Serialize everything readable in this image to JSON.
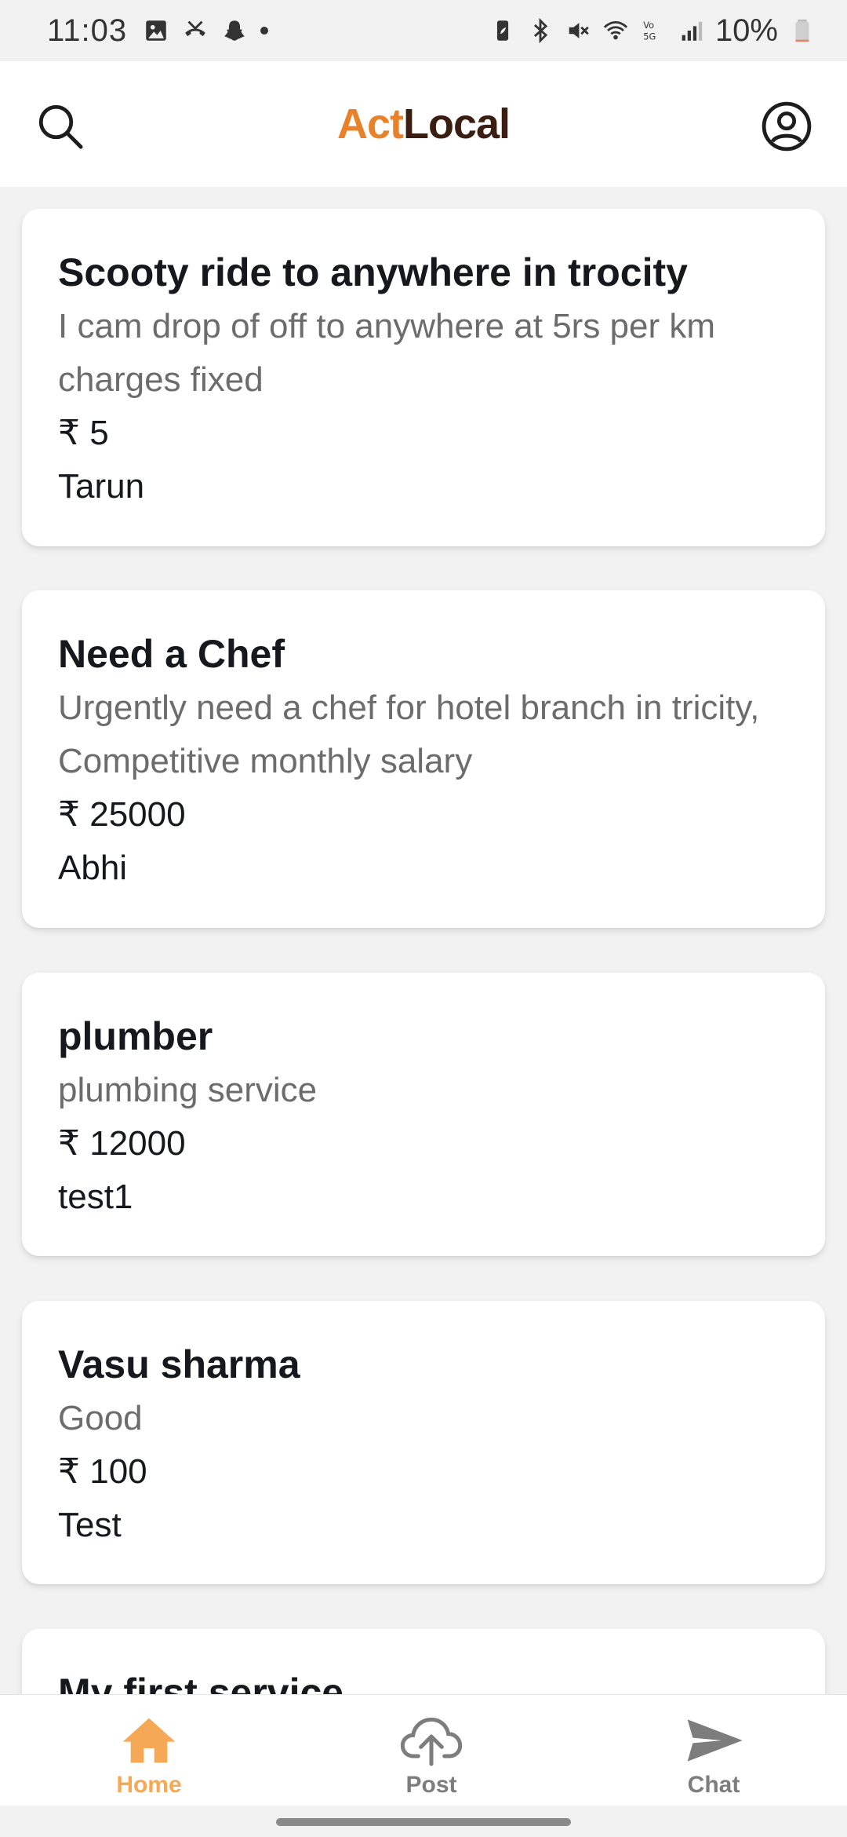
{
  "status_bar": {
    "time": "11:03",
    "battery_percent": "10%",
    "battery_level": 0.1,
    "left_icons": [
      "gallery-icon",
      "missed-call-icon",
      "snapchat-icon",
      "notification-dot"
    ],
    "right_icons": [
      "battery-saver-icon",
      "bluetooth-icon",
      "mute-icon",
      "wifi-icon",
      "volte-5g-icon",
      "signal-icon",
      "battery-icon"
    ]
  },
  "header": {
    "brand_part1": "Act",
    "brand_part2": "Local",
    "brand_colors": {
      "act": "#e8822a",
      "local": "#3a1e12"
    },
    "left_icon": "search-icon",
    "right_icon": "profile-icon"
  },
  "listings": [
    {
      "title": "Scooty ride to anywhere in trocity",
      "description": "I cam drop of off to anywhere at 5rs per km charges fixed",
      "price": "₹ 5",
      "author": "Tarun"
    },
    {
      "title": "Need a Chef",
      "description": "Urgently need a chef for hotel branch in tricity, Competitive monthly salary",
      "price": "₹ 25000",
      "author": "Abhi"
    },
    {
      "title": "plumber",
      "description": "plumbing service",
      "price": "₹ 12000",
      "author": "test1"
    },
    {
      "title": "Vasu sharma",
      "description": "Good",
      "price": "₹ 100",
      "author": "Test"
    },
    {
      "title": "My first service"
    }
  ],
  "bottom_nav": {
    "items": [
      {
        "label": "Home",
        "icon": "home-icon",
        "active": true
      },
      {
        "label": "Post",
        "icon": "upload-cloud-icon",
        "active": false
      },
      {
        "label": "Chat",
        "icon": "send-icon",
        "active": false
      }
    ],
    "active_color": "#f5a855",
    "inactive_color": "#7d7d7d"
  }
}
